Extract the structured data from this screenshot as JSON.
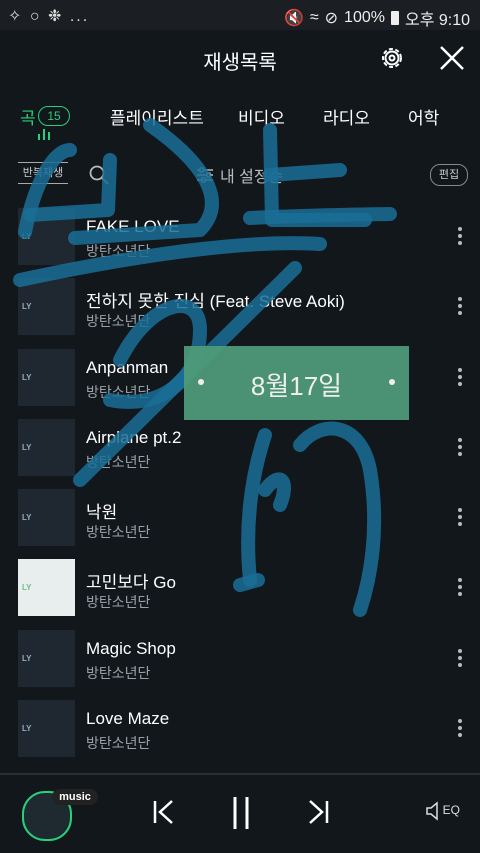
{
  "status_bar": {
    "left_icons": "✧ ○ ❉ ...",
    "battery": "100%",
    "time": "오후 9:10"
  },
  "header": {
    "title": "재생목록"
  },
  "tabs": [
    {
      "label": "곡",
      "count": "15"
    },
    {
      "label": "플레이리스트"
    },
    {
      "label": "비디오"
    },
    {
      "label": "라디오"
    },
    {
      "label": "어학"
    }
  ],
  "toolbar": {
    "repeat_label": "반복재생",
    "sort_label": "내 설정순",
    "edit_label": "편집"
  },
  "songs": [
    {
      "title": "FAKE LOVE",
      "artist": "방탄소년단"
    },
    {
      "title": "전하지 못한 진심 (Feat. Steve Aoki)",
      "artist": "방탄소년단"
    },
    {
      "title": "Anpanman",
      "artist": "방탄소년단"
    },
    {
      "title": "Airplane pt.2",
      "artist": "방탄소년단"
    },
    {
      "title": "낙원",
      "artist": "방탄소년단"
    },
    {
      "title": "고민보다 Go",
      "artist": "방탄소년단"
    },
    {
      "title": "Magic Shop",
      "artist": "방탄소년단"
    },
    {
      "title": "Love Maze",
      "artist": "방탄소년단"
    }
  ],
  "album_tag": "LY",
  "overlay": {
    "date": "8월17일"
  },
  "player": {
    "tag": "music",
    "eq_label": "EQ"
  },
  "colors": {
    "accent": "#28d07a",
    "background": "#12171c",
    "overlay_stroke": "#1a6f97",
    "badge": "#4f9c7a"
  }
}
